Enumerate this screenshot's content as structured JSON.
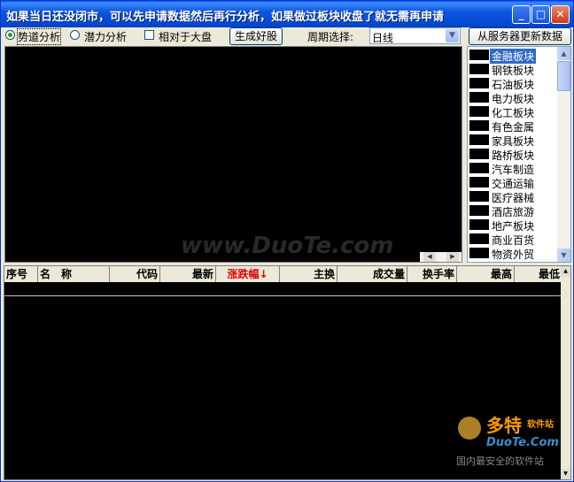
{
  "window": {
    "title": "如果当日还没闭市，可以先申请数据然后再行分析，如果做过板块收盘了就无需再申请",
    "minimize": "_",
    "maximize": "□",
    "close": "✕"
  },
  "toolbar": {
    "mode_trend": "势道分析",
    "mode_potential": "潜力分析",
    "relative_to_market": "相对于大盘",
    "generate_button": "生成好股",
    "period_label": "周期选择:",
    "period_value": "日线",
    "update_button": "从服务器更新数据"
  },
  "chart": {
    "watermark": "www.DuoTe.com"
  },
  "sectors": [
    {
      "label": "金融板块",
      "selected": true
    },
    {
      "label": "钢铁板块"
    },
    {
      "label": "石油板块"
    },
    {
      "label": "电力板块"
    },
    {
      "label": "化工板块"
    },
    {
      "label": "有色金属"
    },
    {
      "label": "家具板块"
    },
    {
      "label": "路桥板块"
    },
    {
      "label": "汽车制造"
    },
    {
      "label": "交通运输"
    },
    {
      "label": "医疗器械"
    },
    {
      "label": "酒店旅游"
    },
    {
      "label": "地产板块"
    },
    {
      "label": "商业百货"
    },
    {
      "label": "物资外贸"
    }
  ],
  "table": {
    "columns": [
      "序号",
      "名　称",
      "代码",
      "最新",
      "涨跌幅↓",
      "主换",
      "成交量",
      "换手率",
      "最高",
      "最低"
    ]
  },
  "logo": {
    "brand": "多特",
    "brand_suffix": "软件站",
    "domain": "DuoTe.Com",
    "slogan": "国内最安全的软件站"
  }
}
